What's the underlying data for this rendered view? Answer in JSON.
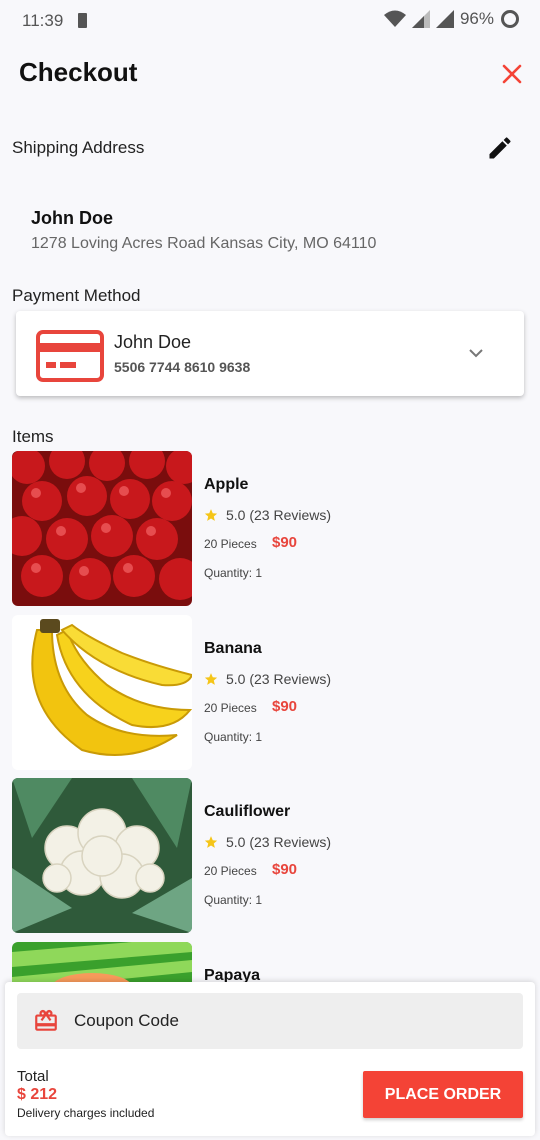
{
  "status_bar": {
    "time": "11:39",
    "battery_percent": "96%"
  },
  "header": {
    "title": "Checkout"
  },
  "shipping": {
    "label": "Shipping Address",
    "name": "John Doe",
    "address": "1278 Loving Acres Road Kansas City, MO 64110"
  },
  "payment": {
    "label": "Payment Method",
    "card_holder": "John Doe",
    "card_number": "5506 7744 8610 9638"
  },
  "items_label": "Items",
  "items": [
    {
      "name": "Apple",
      "rating": "5.0 (23 Reviews)",
      "pieces": "20 Pieces",
      "price": "$90",
      "quantity": "Quantity: 1"
    },
    {
      "name": "Banana",
      "rating": "5.0 (23 Reviews)",
      "pieces": "20 Pieces",
      "price": "$90",
      "quantity": "Quantity: 1"
    },
    {
      "name": "Cauliflower",
      "rating": "5.0 (23 Reviews)",
      "pieces": "20 Pieces",
      "price": "$90",
      "quantity": "Quantity: 1"
    },
    {
      "name": "Papaya"
    }
  ],
  "coupon": {
    "label": "Coupon Code"
  },
  "footer": {
    "total_label": "Total",
    "total_value": "$ 212",
    "delivery_note": "Delivery charges included",
    "place_order_label": "PLACE ORDER"
  },
  "colors": {
    "accent": "#f44336",
    "price": "#e8453c",
    "star": "#f5c518"
  }
}
